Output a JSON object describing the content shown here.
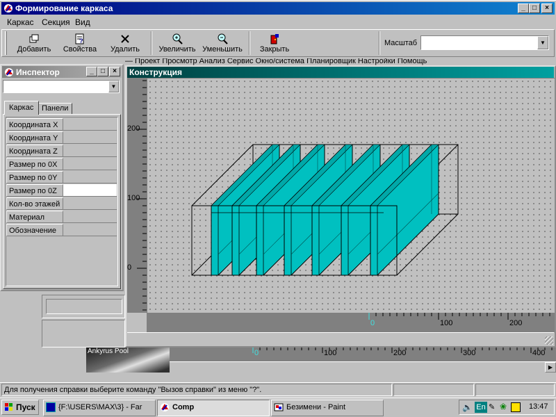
{
  "main_window": {
    "title": "Формирование каркаса",
    "menu": [
      "Каркас",
      "Секция",
      "Вид"
    ],
    "toolbar": {
      "add": "Добавить",
      "properties": "Свойства",
      "delete": "Удалить",
      "zoom_in": "Увеличить",
      "zoom_out": "Уменьшить",
      "close": "Закрыть",
      "scale_label": "Масштаб",
      "scale_value": ""
    }
  },
  "inspector": {
    "title": "Инспектор",
    "object_value": "",
    "tabs": [
      "Каркас",
      "Панели"
    ],
    "properties": [
      {
        "name": "Координата X",
        "value": ""
      },
      {
        "name": "Координата Y",
        "value": ""
      },
      {
        "name": "Координата Z",
        "value": ""
      },
      {
        "name": "Размер по 0X",
        "value": ""
      },
      {
        "name": "Размер по 0Y",
        "value": ""
      },
      {
        "name": "Размер по 0Z",
        "value": ""
      },
      {
        "name": "Кол-во этажей",
        "value": ""
      },
      {
        "name": "Материал",
        "value": ""
      },
      {
        "name": "Обозначение",
        "value": ""
      }
    ]
  },
  "construction": {
    "title": "Конструкция",
    "vertical_ruler": [
      "200",
      "100",
      "0"
    ],
    "horizontal_ruler": [
      "0",
      "100",
      "200"
    ]
  },
  "background": {
    "ruler": [
      "0",
      "100",
      "200",
      "300",
      "400"
    ],
    "menu_fragments": "— Проект   Просмотр   Анализ   Сервис   Окно/система   Планировщик   Настройки   Помощь",
    "thumb_label": "Ankyrus Pool"
  },
  "statusbar": {
    "text": "Для получения справки выберите команду \"Вызов справки\" из меню \"?\"."
  },
  "taskbar": {
    "start": "Пуск",
    "tasks": [
      "{F:\\USERS\\MAX\\3} - Far",
      "Comp",
      "Безимени - Paint"
    ],
    "lang": "En",
    "clock": "13:47"
  },
  "colors": {
    "title_active": "#000080",
    "panel_fill": "#00c0c0",
    "panel_shade": "#00a8a8"
  }
}
